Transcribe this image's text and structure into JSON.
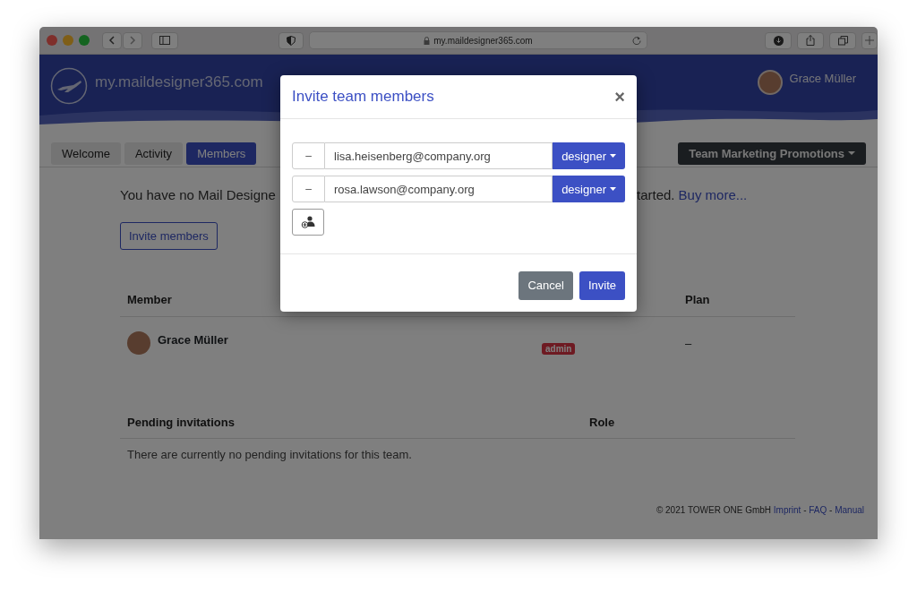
{
  "browser": {
    "url": "my.maildesigner365.com"
  },
  "header": {
    "logo_text": "my.maildesigner365.com",
    "user_name": "Grace Müller"
  },
  "tabs": [
    {
      "label": "Welcome",
      "selected": false
    },
    {
      "label": "Activity",
      "selected": false
    },
    {
      "label": "Members",
      "selected": true
    }
  ],
  "team_menu": {
    "label": "Team Marketing Promotions"
  },
  "notice": {
    "text_start": "You have no Mail Designe",
    "text_end": "tarted.",
    "link": "Buy more..."
  },
  "invite_button": {
    "label": "Invite members"
  },
  "members_table": {
    "columns": [
      "Member",
      "Plan"
    ],
    "rows": [
      {
        "name": "Grace Müller",
        "role_badge": "admin",
        "plan": "–"
      }
    ]
  },
  "pending_table": {
    "columns": [
      "Pending invitations",
      "Role"
    ],
    "empty_message": "There are currently no pending invitations for this team."
  },
  "footer": {
    "copyright": "© 2021 TOWER ONE GmbH",
    "links": [
      "Imprint",
      "FAQ",
      "Manual"
    ],
    "separator": "-"
  },
  "modal": {
    "title": "Invite team members",
    "close": "×",
    "rows": [
      {
        "remove": "–",
        "email": "lisa.heisenberg@company.org",
        "role": "designer"
      },
      {
        "remove": "–",
        "email": "rosa.lawson@company.org",
        "role": "designer"
      }
    ],
    "buttons": [
      {
        "label": "Cancel",
        "kind": "secondary"
      },
      {
        "label": "Invite",
        "kind": "primary"
      }
    ]
  }
}
